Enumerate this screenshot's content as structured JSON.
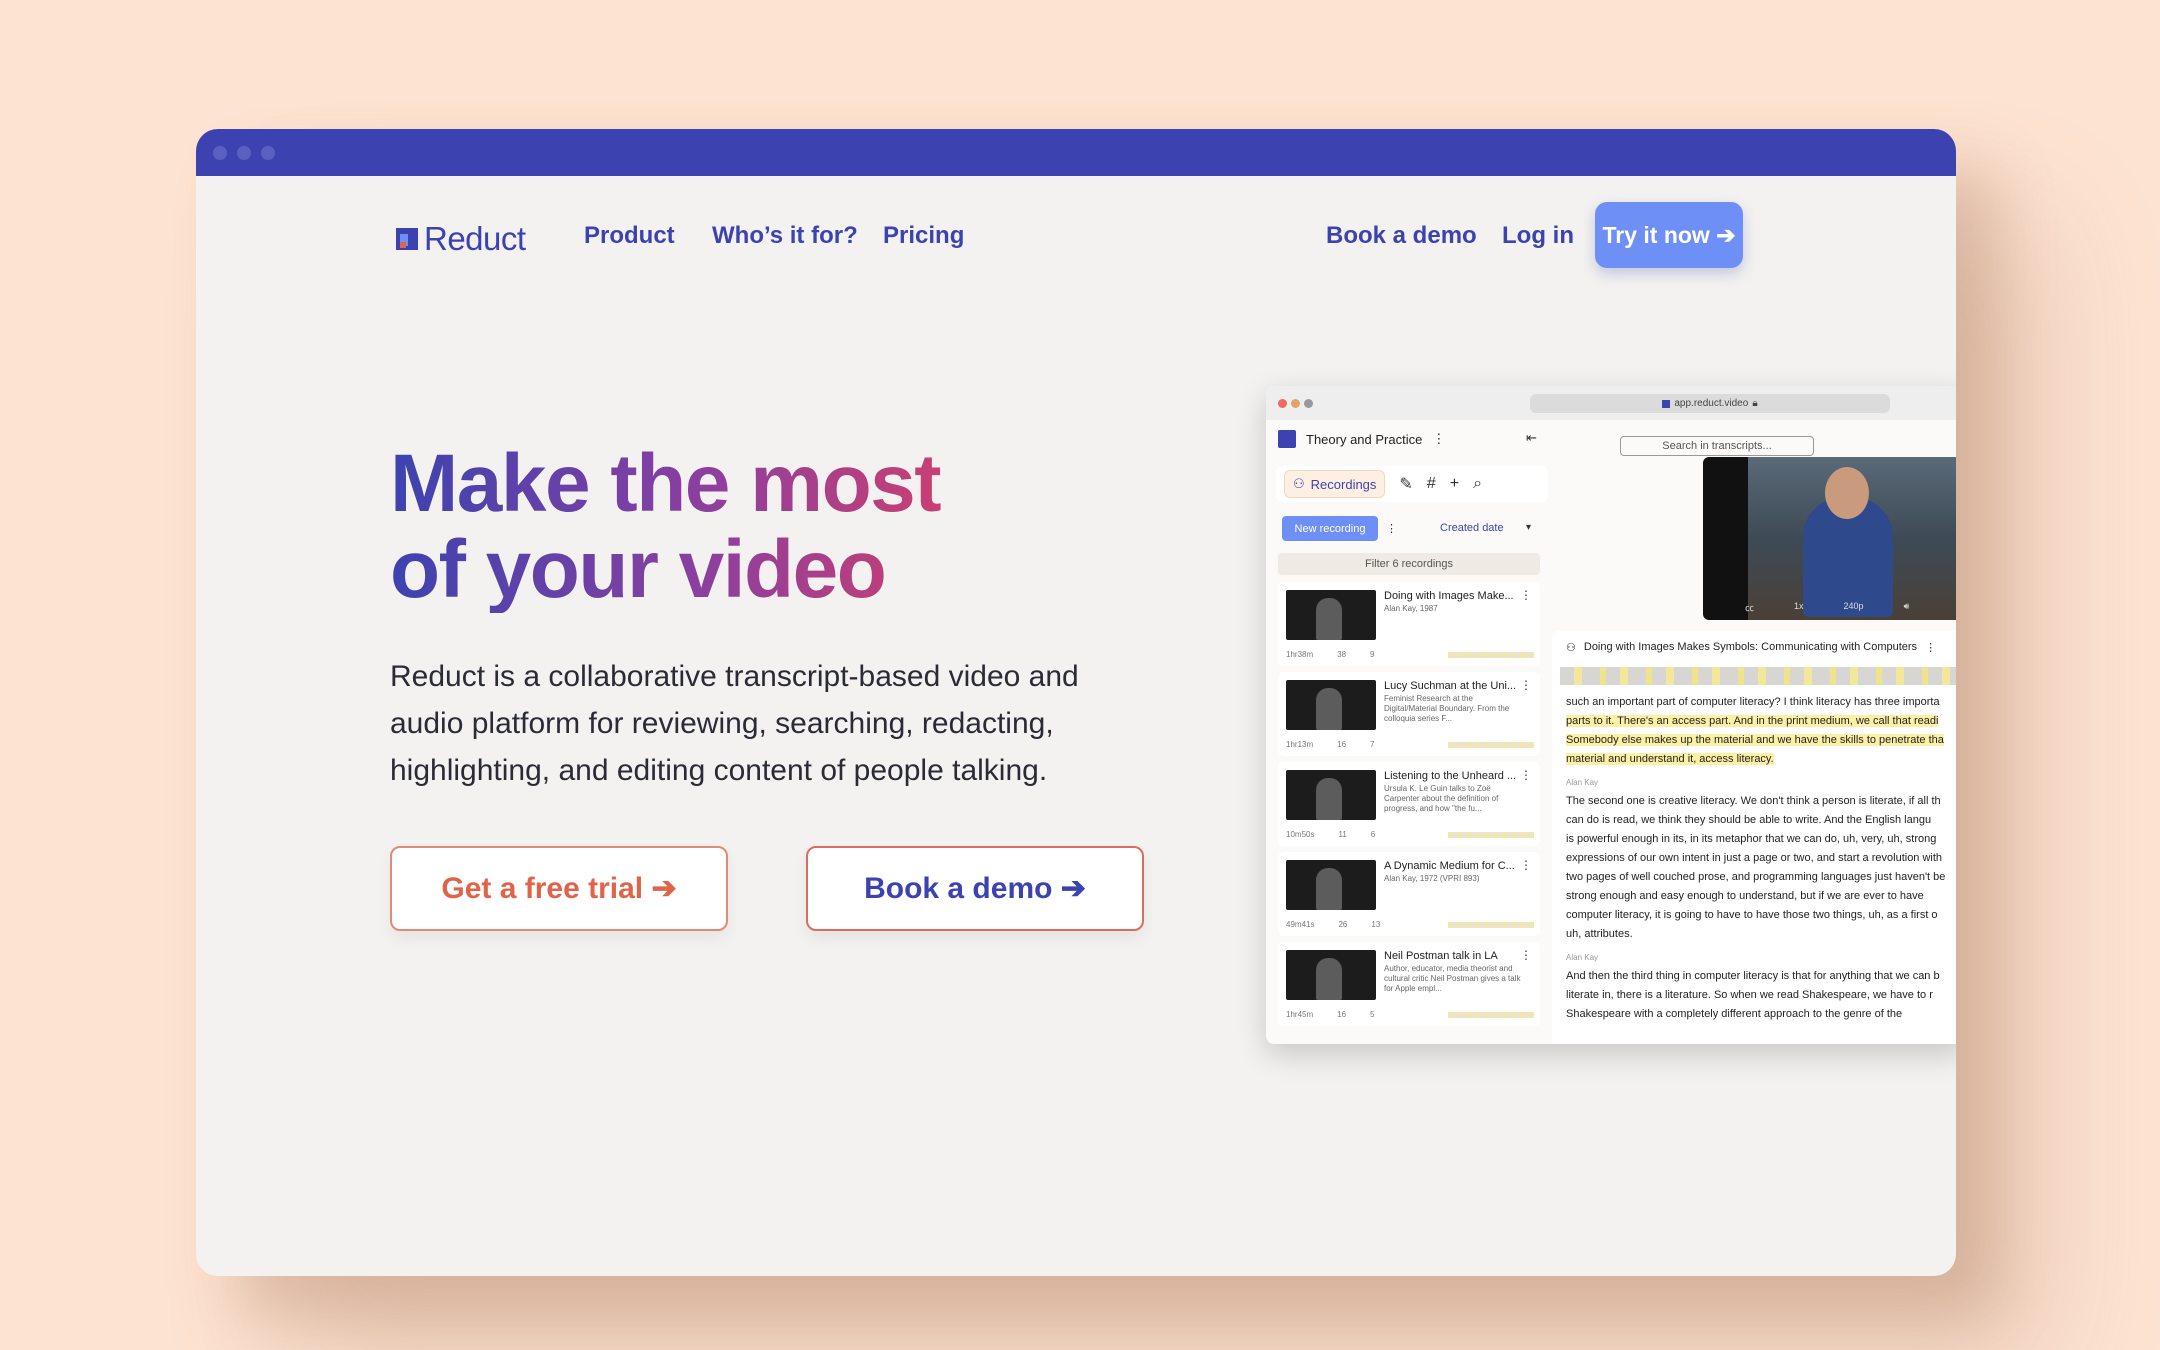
{
  "nav": {
    "logo": "Reduct",
    "links": [
      "Product",
      "Who’s it for?",
      "Pricing"
    ],
    "book_demo": "Book a demo",
    "login": "Log in",
    "try_now": "Try it now ➔"
  },
  "hero": {
    "title_line1": "Make the most",
    "title_line2": "of your video",
    "subtitle": "Reduct is a collaborative transcript-based video and audio platform for reviewing, searching, redacting, highlighting, and editing content of people talking.",
    "cta_trial": "Get a free trial ➔",
    "cta_demo": "Book a demo ➔"
  },
  "app": {
    "url": "app.reduct.video",
    "project": "Theory and Practice",
    "search_placeholder": "Search in transcripts...",
    "tab_recordings": "Recordings",
    "new_recording": "New recording",
    "sort_label": "Created date",
    "filter": "Filter 6 recordings",
    "recordings": [
      {
        "title": "Doing with Images Make...",
        "desc": "Alan Kay, 1987",
        "duration": "1hr38m",
        "clips": "38",
        "tags": "9"
      },
      {
        "title": "Lucy Suchman at the Uni...",
        "desc": "Feminist Research at the Digital/Material Boundary. From the colloquia series F...",
        "duration": "1hr13m",
        "clips": "16",
        "tags": "7"
      },
      {
        "title": "Listening to the Unheard ...",
        "desc": "Ursula K. Le Guin talks to Zoë Carpenter about the definition of progress, and how \"the fu...",
        "duration": "10m50s",
        "clips": "11",
        "tags": "6"
      },
      {
        "title": "A Dynamic Medium for C...",
        "desc": "Alan Kay, 1972 (VPRI 893)",
        "duration": "49m41s",
        "clips": "26",
        "tags": "13"
      },
      {
        "title": "Neil Postman talk in LA",
        "desc": "Author, educator, media theorist and cultural critic Neil Postman gives a talk for Apple empl...",
        "duration": "1hr45m",
        "clips": "16",
        "tags": "5"
      }
    ],
    "video_controls": [
      "1x",
      "240p"
    ],
    "doc_title": "Doing with Images Makes Symbols: Communicating with Computers",
    "speaker": "Alan Kay",
    "transcript": [
      {
        "text": "such an important part of computer literacy? I think literacy has three importa",
        "hl": false
      },
      {
        "text": "parts to it. There's an access part. And in the print medium, we call that readi",
        "hl": true
      },
      {
        "text": "Somebody else makes up the material and we have the skills to penetrate tha",
        "hl": true
      },
      {
        "text": "material and understand it, access literacy.",
        "hl": true
      },
      {
        "text": "The second one is creative literacy. We don't think a person is literate, if all th",
        "hl": false
      },
      {
        "text": "can do is read, we think they should be able to write. And the English langu",
        "hl": false
      },
      {
        "text": "is powerful enough in its, in its metaphor that we can do, uh, very, uh, strong",
        "hl": false
      },
      {
        "text": "expressions of our own intent in just a page or two, and start a revolution with",
        "hl": false
      },
      {
        "text": "two pages of well couched prose, and programming languages just haven't be",
        "hl": false
      },
      {
        "text": "strong enough and easy enough to understand, but if we are ever to have",
        "hl": false
      },
      {
        "text": "computer literacy, it is going to have to have those two things, uh, as a first o",
        "hl": false
      },
      {
        "text": "uh, attributes.",
        "hl": false
      },
      {
        "text": "And then the third thing in computer literacy is that for anything that we can b",
        "hl": false
      },
      {
        "text": "literate in, there is a literature. So when we read Shakespeare, we have to r",
        "hl": false
      },
      {
        "text": "Shakespeare with a completely different approach to the genre of the",
        "hl": false
      }
    ]
  },
  "colors": {
    "brand": "#3c43b0",
    "accent": "#6e8ff6",
    "trial": "#e0644a",
    "background": "#fde3d1"
  }
}
